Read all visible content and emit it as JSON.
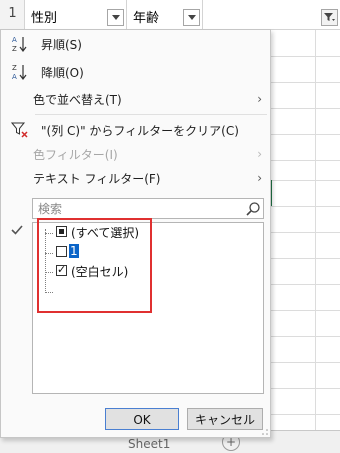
{
  "sheet": {
    "row_number": "1",
    "columns": [
      {
        "header": "性別"
      },
      {
        "header": "年齢"
      },
      {
        "header": ""
      }
    ],
    "sheet_tab": "Sheet1",
    "add_sheet": "+"
  },
  "menu": {
    "sort_asc": "昇順(S)",
    "sort_desc": "降順(O)",
    "sort_by_color": "色で並べ替え(T)",
    "clear_filter": "\"(列 C)\" からフィルターをクリア(C)",
    "color_filter": "色フィルター(I)",
    "text_filter": "テキスト フィルター(F)",
    "submenu_arrow": "›"
  },
  "search": {
    "placeholder": "検索",
    "value": ""
  },
  "values_list": {
    "select_all": "(すべて選択)",
    "items": [
      {
        "label": "1",
        "checked": false
      },
      {
        "label": "(空白セル)",
        "checked": true
      }
    ]
  },
  "buttons": {
    "ok": "OK",
    "cancel": "キャンセル"
  },
  "colors": {
    "highlight_border": "#e03030",
    "selected_value_bg": "#0a64c8",
    "active_cell": "#217346"
  }
}
